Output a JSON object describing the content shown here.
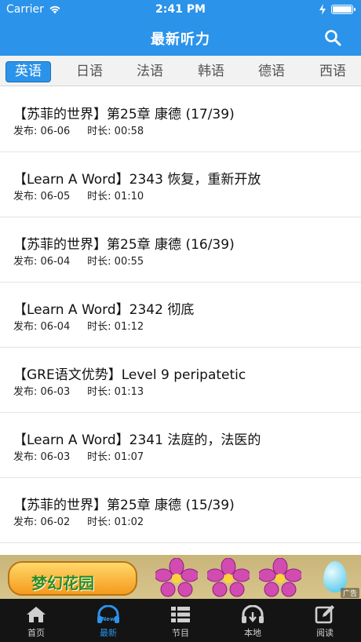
{
  "status": {
    "carrier": "Carrier",
    "time": "2:41 PM"
  },
  "nav": {
    "title": "最新听力"
  },
  "languages": [
    {
      "label": "英语",
      "active": true
    },
    {
      "label": "日语",
      "active": false
    },
    {
      "label": "法语",
      "active": false
    },
    {
      "label": "韩语",
      "active": false
    },
    {
      "label": "德语",
      "active": false
    },
    {
      "label": "西语",
      "active": false
    }
  ],
  "meta_labels": {
    "published": "发布:",
    "duration": "时长:"
  },
  "items": [
    {
      "title": "【苏菲的世界】第25章 康德 (17/39)",
      "date": "06-06",
      "duration": "00:58"
    },
    {
      "title": "【Learn A Word】2343 恢复，重新开放",
      "date": "06-05",
      "duration": "01:10"
    },
    {
      "title": "【苏菲的世界】第25章 康德 (16/39)",
      "date": "06-04",
      "duration": "00:55"
    },
    {
      "title": "【Learn A Word】2342 彻底",
      "date": "06-04",
      "duration": "01:12"
    },
    {
      "title": "【GRE语文优势】Level 9 peripatetic",
      "date": "06-03",
      "duration": "01:13"
    },
    {
      "title": "【Learn A Word】2341 法庭的，法医的",
      "date": "06-03",
      "duration": "01:07"
    },
    {
      "title": "【苏菲的世界】第25章 康德 (15/39)",
      "date": "06-02",
      "duration": "01:02"
    }
  ],
  "ad": {
    "logo_text": "梦幻花园",
    "mark": "广告"
  },
  "tabs": [
    {
      "label": "首页",
      "icon": "home-icon",
      "active": false
    },
    {
      "label": "最新",
      "icon": "headphones-new-icon",
      "active": true,
      "badge": "New"
    },
    {
      "label": "节目",
      "icon": "list-icon",
      "active": false
    },
    {
      "label": "本地",
      "icon": "headphones-download-icon",
      "active": false
    },
    {
      "label": "阅读",
      "icon": "edit-icon",
      "active": false
    }
  ],
  "colors": {
    "accent": "#2b93ea",
    "tabbar": "#141414"
  }
}
